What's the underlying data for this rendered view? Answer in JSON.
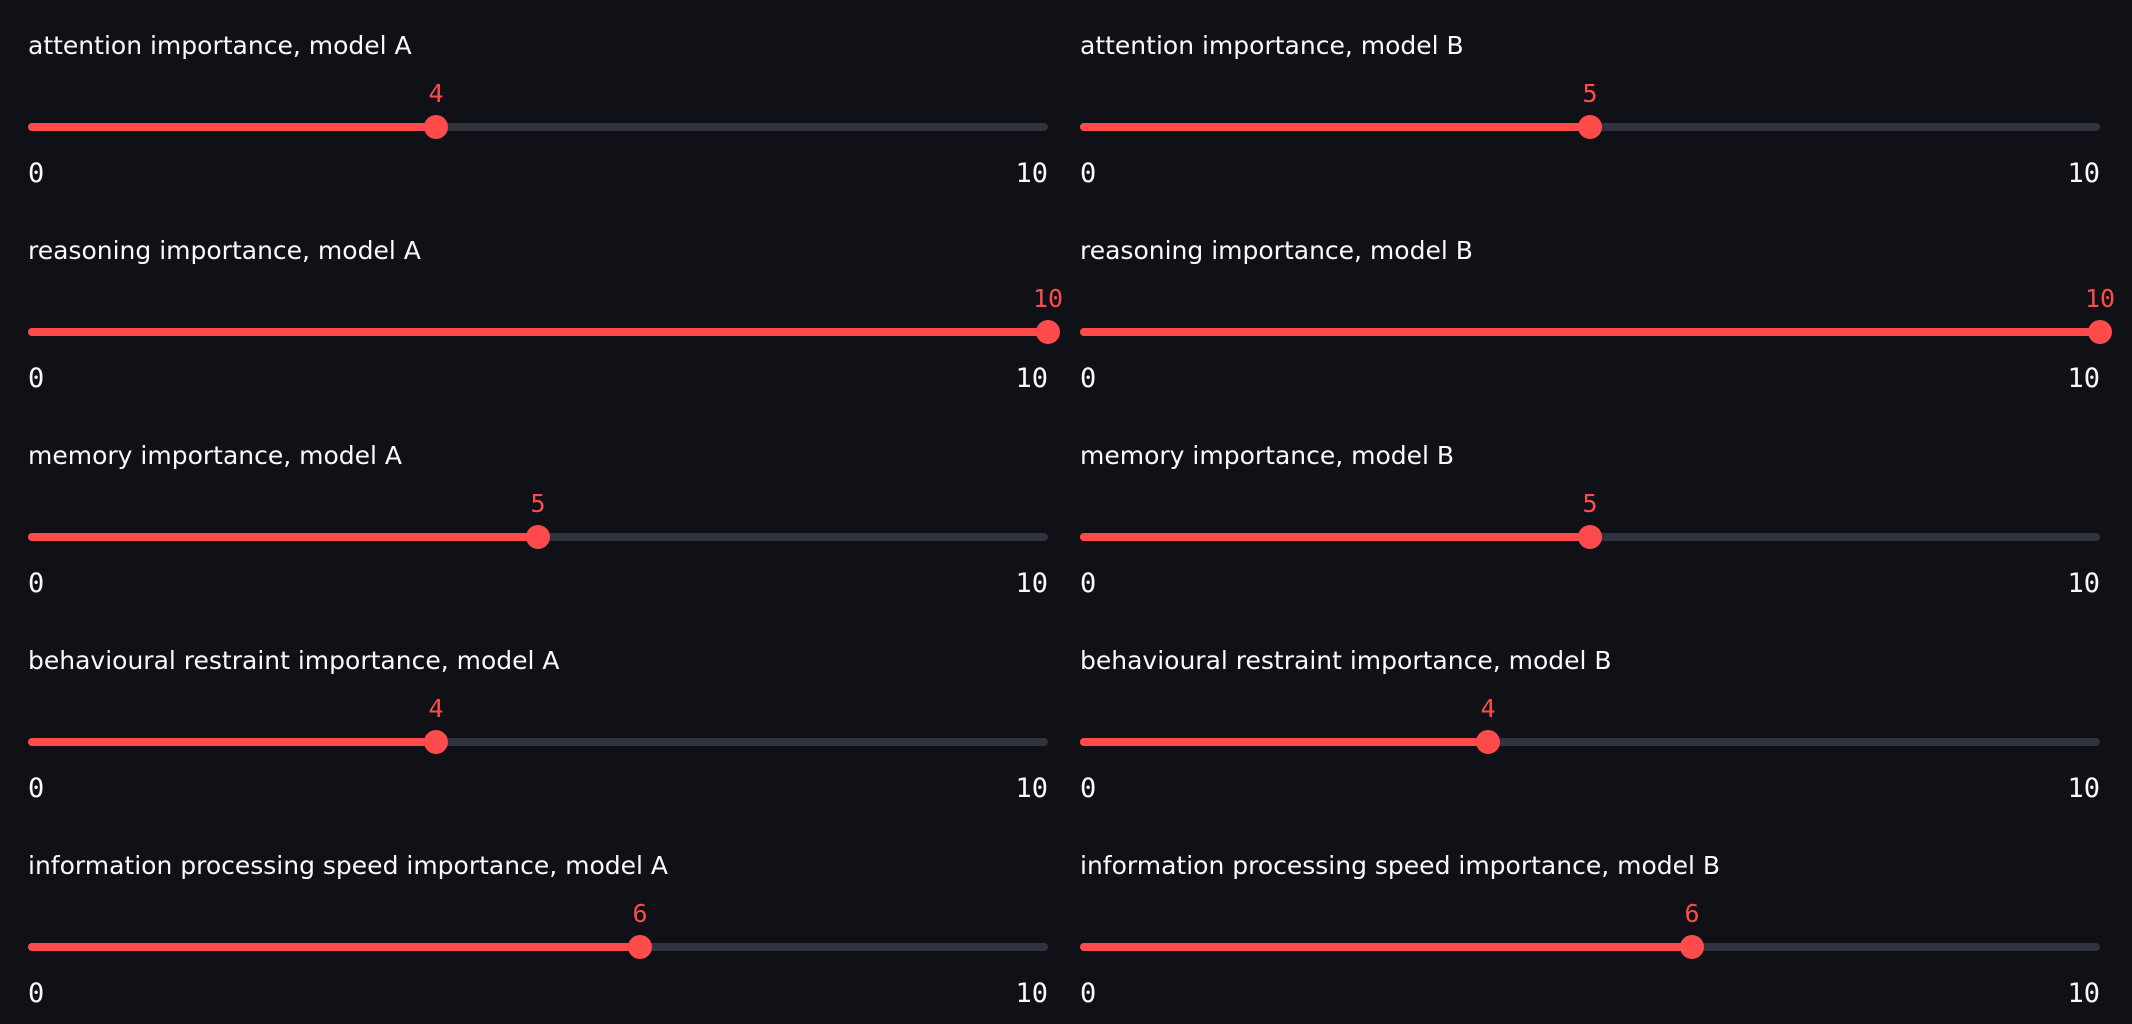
{
  "theme": {
    "background": "#0f1116",
    "accent": "#ff4b4b",
    "track": "#31333f",
    "text": "#fafafa"
  },
  "sliders": [
    {
      "label": "attention importance, model A",
      "value": 4,
      "min": 0,
      "max": 10,
      "min_label": "0",
      "max_label": "10",
      "value_label": "4"
    },
    {
      "label": "attention importance, model B",
      "value": 5,
      "min": 0,
      "max": 10,
      "min_label": "0",
      "max_label": "10",
      "value_label": "5"
    },
    {
      "label": "reasoning importance, model A",
      "value": 10,
      "min": 0,
      "max": 10,
      "min_label": "0",
      "max_label": "10",
      "value_label": "10"
    },
    {
      "label": "reasoning importance, model B",
      "value": 10,
      "min": 0,
      "max": 10,
      "min_label": "0",
      "max_label": "10",
      "value_label": "10"
    },
    {
      "label": "memory importance, model A",
      "value": 5,
      "min": 0,
      "max": 10,
      "min_label": "0",
      "max_label": "10",
      "value_label": "5"
    },
    {
      "label": "memory importance, model B",
      "value": 5,
      "min": 0,
      "max": 10,
      "min_label": "0",
      "max_label": "10",
      "value_label": "5"
    },
    {
      "label": "behavioural restraint importance, model A",
      "value": 4,
      "min": 0,
      "max": 10,
      "min_label": "0",
      "max_label": "10",
      "value_label": "4"
    },
    {
      "label": "behavioural restraint importance, model B",
      "value": 4,
      "min": 0,
      "max": 10,
      "min_label": "0",
      "max_label": "10",
      "value_label": "4"
    },
    {
      "label": "information processing speed importance, model A",
      "value": 6,
      "min": 0,
      "max": 10,
      "min_label": "0",
      "max_label": "10",
      "value_label": "6"
    },
    {
      "label": "information processing speed importance, model B",
      "value": 6,
      "min": 0,
      "max": 10,
      "min_label": "0",
      "max_label": "10",
      "value_label": "6"
    }
  ]
}
